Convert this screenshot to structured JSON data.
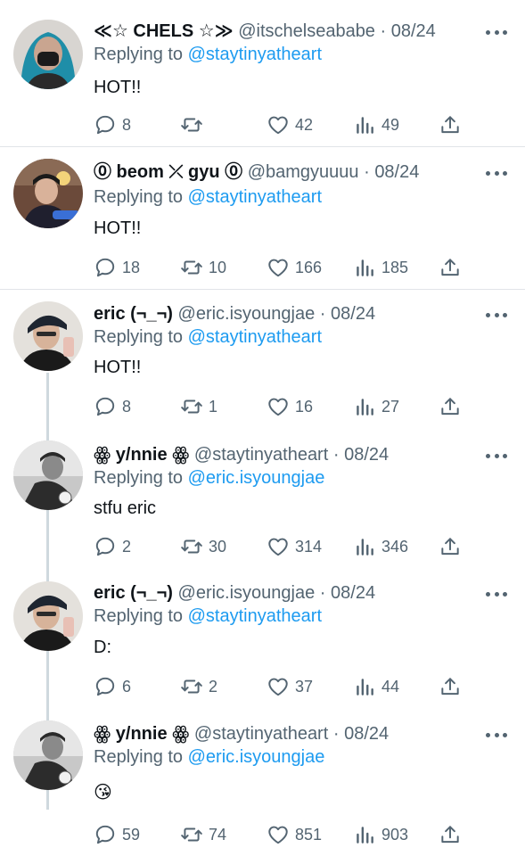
{
  "tweets": [
    {
      "display_name": "≪☆ CHELS ☆≫",
      "handle": "@itschelseababe",
      "sep": "·",
      "date": "08/24",
      "replying_prefix": "Replying to",
      "replying_to": "@staytinyatheart",
      "text": "HOT!!",
      "replies": "8",
      "retweets": "",
      "likes": "42",
      "views": "49"
    },
    {
      "display_name": "⓪ beom ⤫ gyu ⓪",
      "handle": "@bamgyuuuu",
      "sep": "·",
      "date": "08/24",
      "replying_prefix": "Replying to",
      "replying_to": "@staytinyatheart",
      "text": "HOT!!",
      "replies": "18",
      "retweets": "10",
      "likes": "166",
      "views": "185"
    },
    {
      "display_name": "eric (¬_¬)",
      "handle": "@eric.isyoungjae",
      "sep": "·",
      "date": "08/24",
      "replying_prefix": "Replying to",
      "replying_to": "@staytinyatheart",
      "text": "HOT!!",
      "replies": "8",
      "retweets": "1",
      "likes": "16",
      "views": "27"
    },
    {
      "display_name": "ꙮ y/nnie ꙮ",
      "handle": "@staytinyatheart",
      "sep": "·",
      "date": "08/24",
      "replying_prefix": "Replying to",
      "replying_to": "@eric.isyoungjae",
      "text": "stfu eric",
      "replies": "2",
      "retweets": "30",
      "likes": "314",
      "views": "346"
    },
    {
      "display_name": "eric (¬_¬)",
      "handle": "@eric.isyoungjae",
      "sep": "·",
      "date": "08/24",
      "replying_prefix": "Replying to",
      "replying_to": "@staytinyatheart",
      "text": "D:",
      "replies": "6",
      "retweets": "2",
      "likes": "37",
      "views": "44"
    },
    {
      "display_name": "ꙮ y/nnie ꙮ",
      "handle": "@staytinyatheart",
      "sep": "·",
      "date": "08/24",
      "replying_prefix": "Replying to",
      "replying_to": "@eric.isyoungjae",
      "text": "😘",
      "replies": "59",
      "retweets": "74",
      "likes": "851",
      "views": "903"
    }
  ],
  "icons": {
    "reply": "reply-icon",
    "retweet": "retweet-icon",
    "like": "heart-icon",
    "views": "views-icon",
    "share": "share-icon",
    "more": "more-icon"
  },
  "colors": {
    "accent": "#1d9bf0",
    "text": "#0f1419",
    "secondary": "#536471",
    "divider": "#e1e4e8",
    "thread_line": "#cfd9de"
  }
}
